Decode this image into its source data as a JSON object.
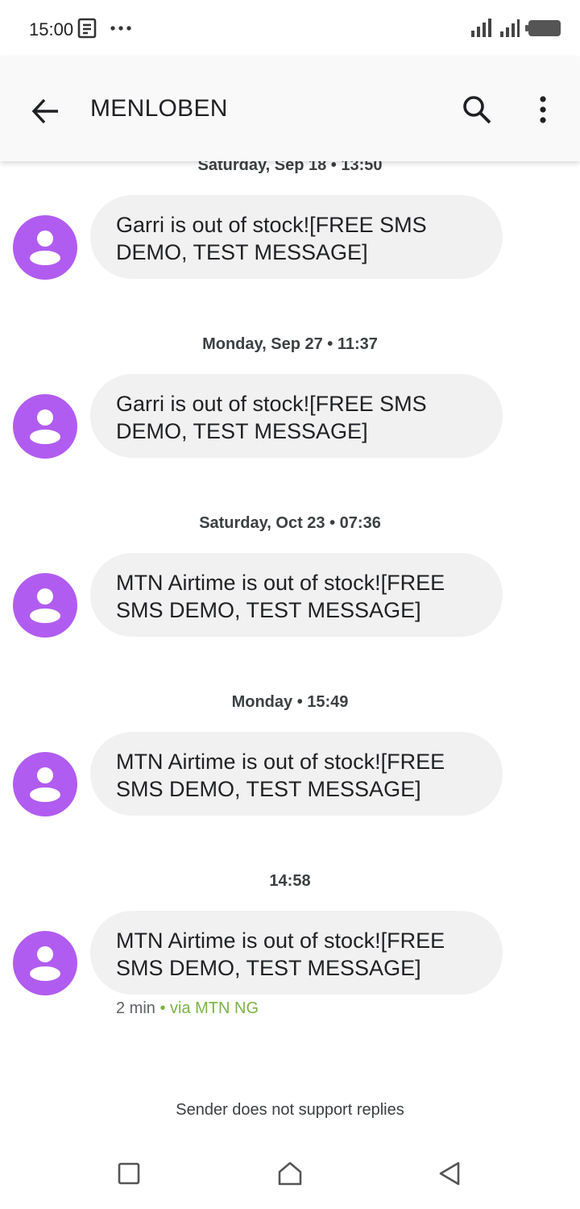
{
  "status_bar": {
    "time": "15:00"
  },
  "app_bar": {
    "title": "MENLOBEN"
  },
  "messages": [
    {
      "date": "Saturday, Sep 18 • 13:50",
      "text_line1": "Garri is out of stock![FREE SMS",
      "text_line2": "DEMO, TEST MESSAGE]"
    },
    {
      "date": "Monday, Sep 27 • 11:37",
      "text_line1": "Garri is out of stock![FREE SMS",
      "text_line2": "DEMO, TEST MESSAGE]"
    },
    {
      "date": "Saturday, Oct 23 • 07:36",
      "text_line1": "MTN Airtime is out of stock![FREE",
      "text_line2": "SMS DEMO, TEST MESSAGE]"
    },
    {
      "date": "Monday • 15:49",
      "text_line1": "MTN Airtime is out of stock![FREE",
      "text_line2": "SMS DEMO, TEST MESSAGE]"
    },
    {
      "date": "14:58",
      "text_line1": "MTN Airtime is out of stock![FREE",
      "text_line2": "SMS DEMO, TEST MESSAGE]",
      "meta_time": "2 min",
      "meta_via": "• via MTN NG"
    }
  ],
  "footer": {
    "no_reply_text": "Sender does not support replies"
  },
  "colors": {
    "avatar": "#b15cf0",
    "bubble": "#f1f1f1",
    "via": "#7cb342"
  },
  "icons": [
    "back-arrow-icon",
    "search-icon",
    "more-vert-icon",
    "person-icon",
    "square-icon",
    "home-icon",
    "back-triangle-icon"
  ]
}
